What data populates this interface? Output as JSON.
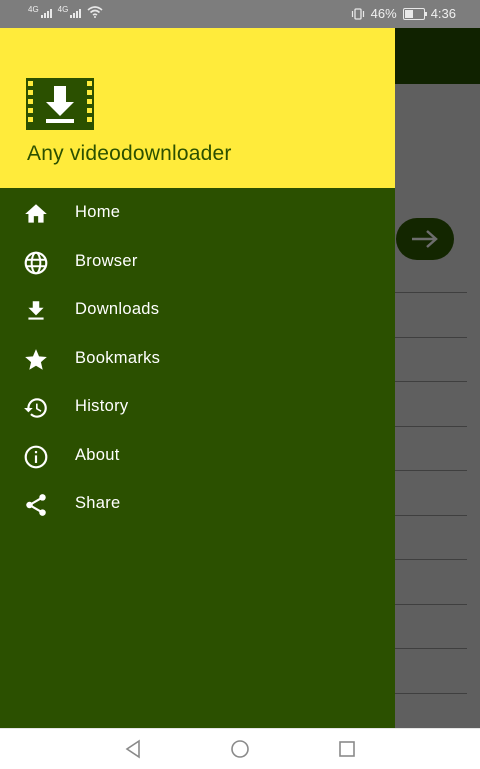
{
  "status_bar": {
    "battery_percent": "46%",
    "battery_level": 0.46,
    "time": "4:36",
    "signal_label": "4G"
  },
  "drawer": {
    "app_title": "Any videodownloader",
    "header_color": "#ffeb3b",
    "body_color": "#2b5000",
    "logo_icon": "download-film-icon",
    "items": [
      {
        "label": "Home",
        "icon": "home-icon"
      },
      {
        "label": "Browser",
        "icon": "globe-icon"
      },
      {
        "label": "Downloads",
        "icon": "download-icon"
      },
      {
        "label": "Bookmarks",
        "icon": "star-icon"
      },
      {
        "label": "History",
        "icon": "history-icon"
      },
      {
        "label": "About",
        "icon": "info-icon"
      },
      {
        "label": "Share",
        "icon": "share-icon"
      }
    ]
  },
  "nav_bar": {
    "buttons": [
      "back-icon",
      "home-circle-icon",
      "recents-icon"
    ]
  }
}
